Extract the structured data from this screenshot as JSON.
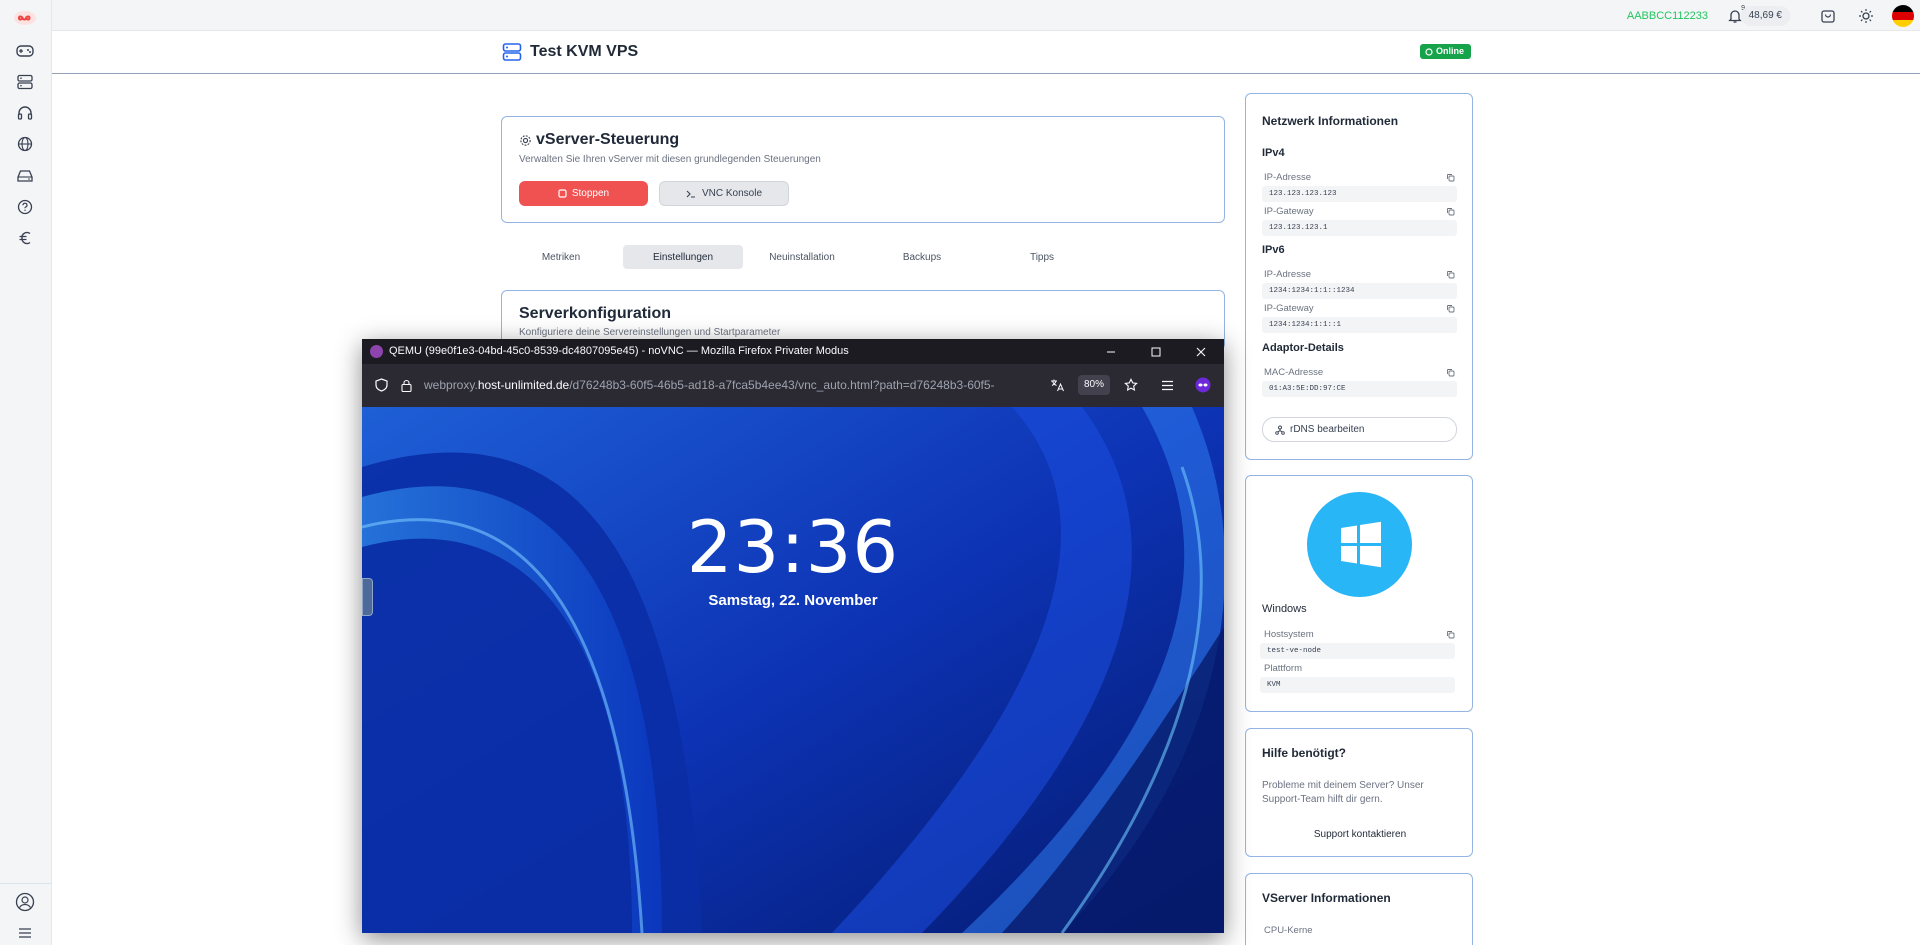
{
  "sidebar": {
    "items": [
      "controller-icon",
      "server-icon",
      "headset-icon",
      "globe-icon",
      "drive-icon",
      "help-icon",
      "euro-icon"
    ],
    "bottom": [
      "user-icon",
      "menu-icon"
    ]
  },
  "topbar": {
    "user_id": "AABBCC112233",
    "notification_count": "9",
    "balance": "48,69 €"
  },
  "header": {
    "title": "Test KVM VPS",
    "status": "Online"
  },
  "control": {
    "title": "vServer-Steuerung",
    "subtitle": "Verwalten Sie Ihren vServer mit diesen grundlegenden Steuerungen",
    "stop_label": "Stoppen",
    "vnc_label": "VNC Konsole"
  },
  "tabs": [
    "Metriken",
    "Einstellungen",
    "Neuinstallation",
    "Backups",
    "Tipps"
  ],
  "active_tab": "Einstellungen",
  "config": {
    "title": "Serverkonfiguration",
    "subtitle": "Konfiguriere deine Servereinstellungen und Startparameter"
  },
  "network": {
    "title": "Netzwerk Informationen",
    "ipv4_heading": "IPv4",
    "ipv4_address_label": "IP-Adresse",
    "ipv4_address": "123.123.123.123",
    "ipv4_gateway_label": "IP-Gateway",
    "ipv4_gateway": "123.123.123.1",
    "ipv6_heading": "IPv6",
    "ipv6_address_label": "IP-Adresse",
    "ipv6_address": "1234:1234:1:1::1234",
    "ipv6_gateway_label": "IP-Gateway",
    "ipv6_gateway": "1234:1234:1:1::1",
    "adaptor_heading": "Adaptor-Details",
    "mac_label": "MAC-Adresse",
    "mac": "01:A3:5E:DD:97:CE",
    "rdns_label": "rDNS bearbeiten"
  },
  "os": {
    "name": "Windows",
    "host_label": "Hostsystem",
    "host": "test-ve-node",
    "platform_label": "Plattform",
    "platform": "KVM"
  },
  "help": {
    "title": "Hilfe benötigt?",
    "text": "Probleme mit deinem Server? Unser Support-Team hilft dir gern.",
    "link": "Support kontaktieren"
  },
  "vserver": {
    "title": "VServer Informationen",
    "cpu_label": "CPU-Kerne"
  },
  "firefox": {
    "title": "QEMU (99e0f1e3-04bd-45c0-8539-dc4807095e45) - noVNC — Mozilla Firefox Privater Modus",
    "url_prefix": "webproxy.",
    "url_host": "host-unlimited.de",
    "url_path": "/d76248b3-60f5-46b5-ad18-a7fca5b4ee43/vnc_auto.html?path=d76248b3-60f5-",
    "zoom": "80%"
  },
  "lockscreen": {
    "time": "23:36",
    "date": "Samstag, 22. November"
  }
}
